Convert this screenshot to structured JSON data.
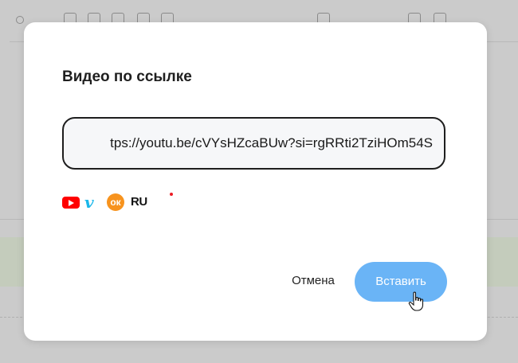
{
  "dialog": {
    "title": "Видео по ссылке",
    "url_value": "tps://youtu.be/cVYsHZcaBUw?si=rgRRti2TziHOm54S",
    "providers": [
      {
        "name": "youtube-icon"
      },
      {
        "name": "vimeo-icon",
        "label": "v"
      },
      {
        "name": "odnoklassniki-icon",
        "label": "ок"
      },
      {
        "name": "rutube-icon",
        "label": "RU"
      }
    ],
    "cancel_label": "Отмена",
    "insert_label": "Вставить"
  },
  "colors": {
    "overlay": "#cbcbcb",
    "modal_bg": "#ffffff",
    "primary_button": "#6ab4f6",
    "field_border": "#1e1e1e",
    "youtube": "#ff0000",
    "vimeo": "#1ab7ea",
    "ok": "#f7931e"
  }
}
